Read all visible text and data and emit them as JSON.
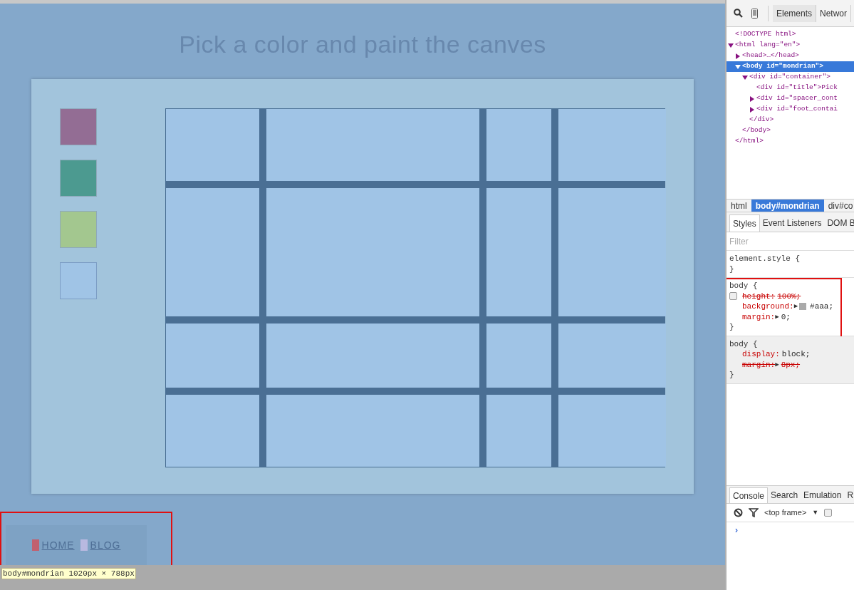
{
  "page": {
    "title": "Pick a color and paint the canves",
    "swatches": [
      {
        "color": "#936d94",
        "selected": false
      },
      {
        "color": "#4c9a90",
        "selected": false
      },
      {
        "color": "#a3c78f",
        "selected": false
      },
      {
        "color": "#a0c4e6",
        "selected": true
      }
    ],
    "footer_links": [
      {
        "label": "HOME",
        "color": "#c1606e"
      },
      {
        "label": "BLOG",
        "color": "#b8b9e0"
      }
    ],
    "tooltip": "body#mondrian 1020px × 788px"
  },
  "devtools": {
    "tabs": [
      {
        "label": "Elements",
        "selected": true
      },
      {
        "label": "Networ",
        "selected": false
      }
    ],
    "dom_tree": [
      {
        "text": "<!DOCTYPE html>",
        "kind": "leaf",
        "selected": false
      },
      {
        "text": "<html lang=\"en\">",
        "kind": "toggle",
        "expanded": true,
        "selected": false,
        "children": [
          {
            "text": "<head>…</head>",
            "kind": "toggle",
            "expanded": false,
            "selected": false
          },
          {
            "text": "<body id=\"mondrian\">",
            "kind": "toggle",
            "expanded": true,
            "selected": true,
            "children": [
              {
                "text": "<div id=\"container\">",
                "kind": "toggle",
                "expanded": true,
                "selected": false,
                "children": [
                  {
                    "text": "<div id=\"title\">Pick",
                    "kind": "leaf",
                    "selected": false
                  },
                  {
                    "text": "<div id=\"spacer_cont",
                    "kind": "toggle",
                    "expanded": false,
                    "selected": false
                  },
                  {
                    "text": "<div id=\"foot_contai",
                    "kind": "toggle",
                    "expanded": false,
                    "selected": false
                  }
                ]
              },
              {
                "text": "</div>",
                "kind": "leaf",
                "selected": false
              }
            ]
          },
          {
            "text": "</body>",
            "kind": "leaf",
            "selected": false
          }
        ]
      },
      {
        "text": "</html>",
        "kind": "leaf",
        "selected": false
      }
    ],
    "breadcrumbs": [
      {
        "label": "html",
        "selected": false
      },
      {
        "label": "body#mondrian",
        "selected": true
      },
      {
        "label": "div#co",
        "selected": false
      }
    ],
    "style_tabs": [
      {
        "label": "Styles",
        "selected": true
      },
      {
        "label": "Event Listeners",
        "selected": false
      },
      {
        "label": "DOM B",
        "selected": false
      }
    ],
    "filter": {
      "placeholder": "Filter"
    },
    "rules": [
      {
        "selector": "element.style {",
        "kind": "author",
        "highlighted": false,
        "close": "}"
      },
      {
        "selector": "body {",
        "kind": "author",
        "highlighted": true,
        "declarations": [
          {
            "property": "height:",
            "value": "100%;",
            "struck": true,
            "checkbox": true,
            "checked": false
          },
          {
            "property": "background:",
            "expander": "▶",
            "swatch": true,
            "value": "#aaa;",
            "struck": false
          },
          {
            "property": "margin:",
            "expander": "▶",
            "value": "0;",
            "struck": false
          }
        ],
        "close": "}"
      },
      {
        "selector": "body {",
        "kind": "user-agent",
        "highlighted": false,
        "declarations": [
          {
            "property": "display:",
            "value": "block;",
            "struck": false
          },
          {
            "property": "margin:",
            "expander": "▶",
            "value": "8px;",
            "struck": true
          }
        ],
        "close": "}"
      }
    ],
    "drawer_tabs": [
      {
        "label": "Console",
        "selected": true
      },
      {
        "label": "Search",
        "selected": false
      },
      {
        "label": "Emulation",
        "selected": false
      },
      {
        "label": "R",
        "selected": false
      }
    ],
    "console_toolbar": {
      "context": "<top frame>",
      "dropdown": "▼",
      "checked": false
    },
    "prompt": "›"
  }
}
